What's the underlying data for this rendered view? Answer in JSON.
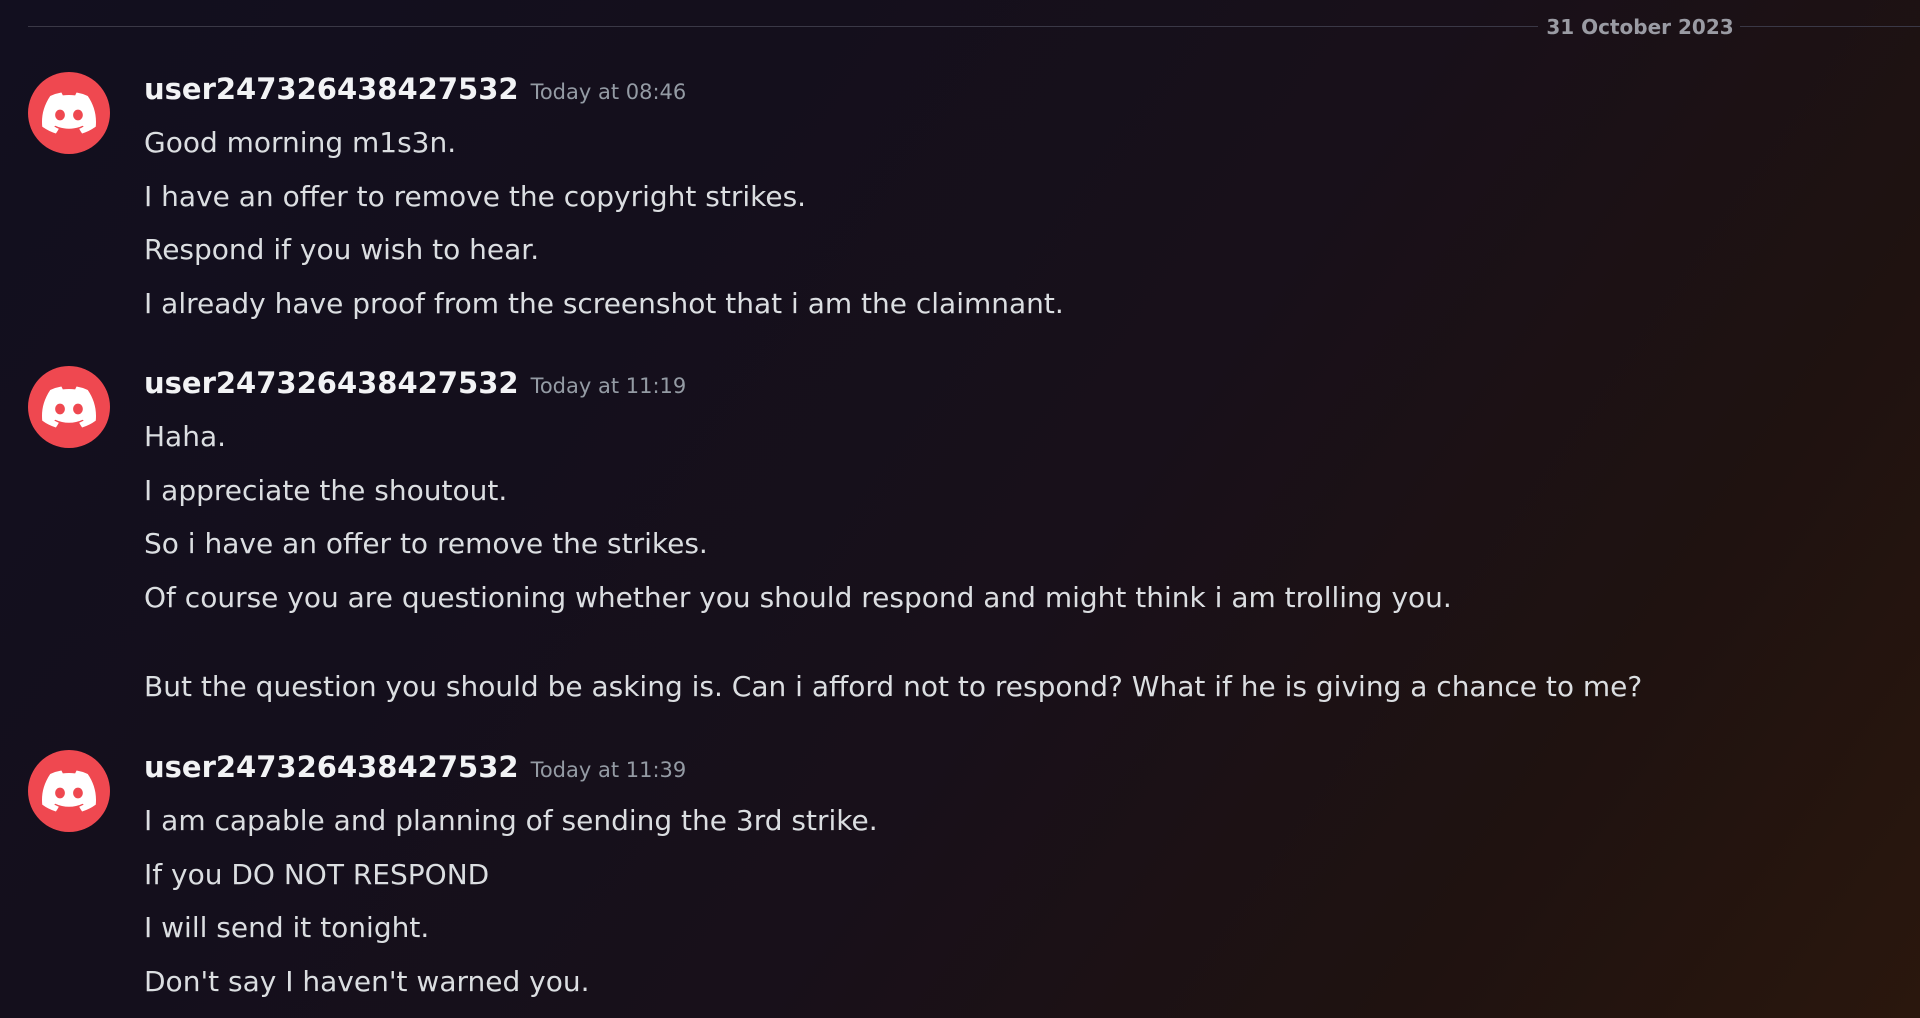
{
  "divider": {
    "date": "31 October 2023"
  },
  "messages": [
    {
      "username": "user247326438427532",
      "timestamp": "Today at 08:46",
      "lines": [
        "Good morning m1s3n.",
        "I have an offer to remove the copyright strikes.",
        "Respond if you wish to hear.",
        "I already have proof from the screenshot that i am the claimnant."
      ]
    },
    {
      "username": "user247326438427532",
      "timestamp": "Today at 11:19",
      "lines": [
        "Haha.",
        "I appreciate the shoutout.",
        "So i have an offer to remove the strikes.",
        "Of course you are questioning whether you should respond and might think i am trolling you.",
        "But the question you should be asking is. Can i afford not to respond? What if he is giving a chance to me?"
      ]
    },
    {
      "username": "user247326438427532",
      "timestamp": "Today at 11:39",
      "lines": [
        "I am capable and planning of sending the 3rd strike.",
        "If you DO NOT RESPOND",
        "I will send it tonight.",
        "Don't say I haven't warned you."
      ]
    }
  ],
  "colors": {
    "avatar_bg": "#ef4850",
    "username": "#f2f3f5",
    "timestamp": "#949ba4",
    "message_text": "#dbdee1"
  },
  "icons": {
    "avatar": "discord-logo-icon"
  }
}
